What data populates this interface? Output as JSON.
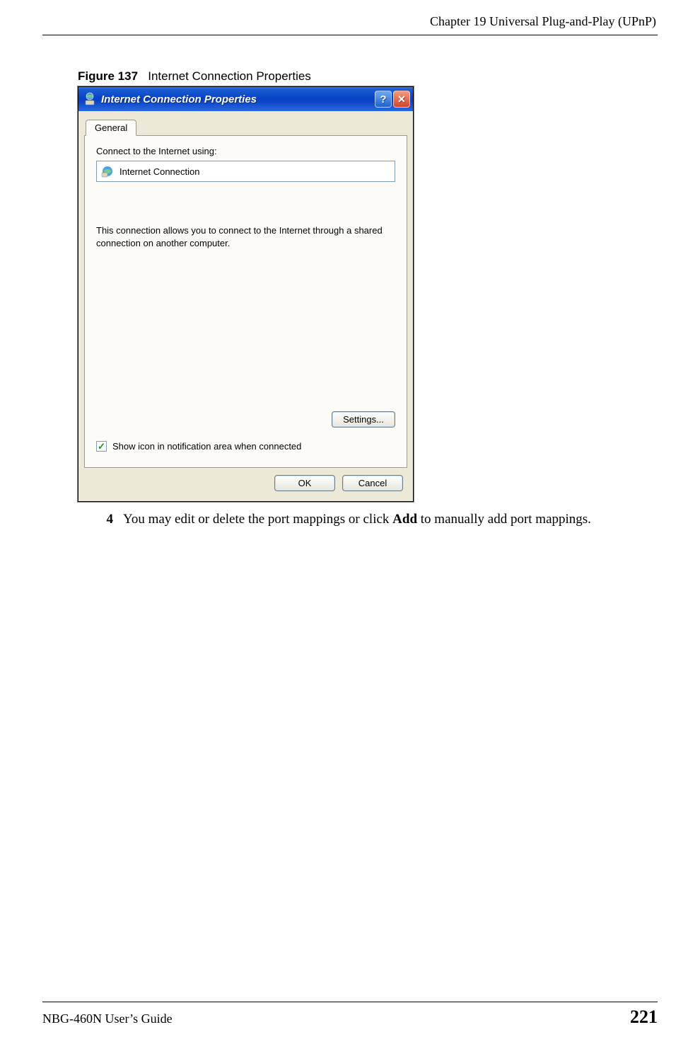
{
  "header": {
    "chapter": "Chapter 19 Universal Plug-and-Play (UPnP)"
  },
  "figure": {
    "label": "Figure 137",
    "caption": "Internet Connection Properties"
  },
  "dialog": {
    "title": "Internet Connection Properties",
    "help_symbol": "?",
    "close_symbol": "✕",
    "tab_label": "General",
    "connect_label": "Connect to the Internet using:",
    "connection_name": "Internet Connection",
    "description": "This connection allows you to connect to the Internet through a shared connection on another computer.",
    "settings_button": "Settings...",
    "checkbox_checked": true,
    "checkbox_label": "Show icon in notification area when connected",
    "ok_button": "OK",
    "cancel_button": "Cancel"
  },
  "step": {
    "number": "4",
    "text_before": "You may edit or delete the port mappings or click ",
    "bold": "Add",
    "text_after": " to manually add port mappings."
  },
  "footer": {
    "guide": "NBG-460N User’s Guide",
    "page": "221"
  }
}
